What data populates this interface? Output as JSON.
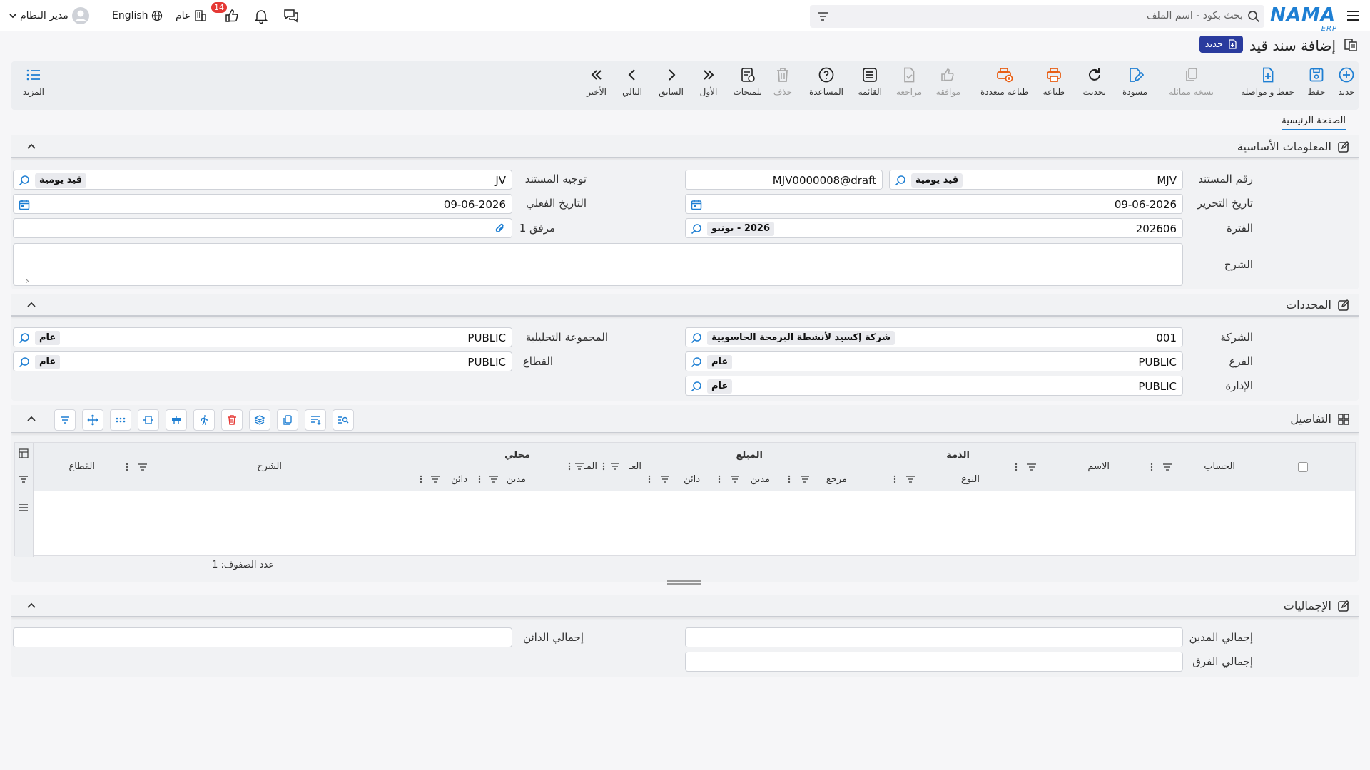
{
  "topbar": {
    "logo": "NAMA",
    "logo_sub": "ERP",
    "search_placeholder": "بحث بكود - اسم الملف",
    "user_name": "مدير النظام",
    "language": "English",
    "scope": "عام",
    "notification_count": "14"
  },
  "page": {
    "title": "إضافة سند قيد",
    "new_badge": "جديد"
  },
  "toolbar": {
    "new": "جديد",
    "save": "حفظ",
    "save_continue": "حفظ و مواصلة",
    "copy": "نسخة مماثلة",
    "draft": "مسودة",
    "refresh": "تحديث",
    "print": "طباعة",
    "multi_print": "طباعة متعددة",
    "approve": "موافقة",
    "review": "مراجعة",
    "list": "القائمة",
    "help": "المساعدة",
    "delete": "حذف",
    "hints": "تلميحات",
    "first": "الأول",
    "previous": "السابق",
    "next": "التالي",
    "last": "الأخير",
    "more": "المزيد"
  },
  "tabs": {
    "main": "الصفحة الرئيسية"
  },
  "basic": {
    "title": "المعلومات الأساسية",
    "doc_number_label": "رقم المستند",
    "doc_type_code": "MJV",
    "doc_type_name": "قيد يومية",
    "doc_code": "MJV0000008@draft",
    "doc_direction_label": "توجيه المستند",
    "doc_direction_code": "JV",
    "doc_direction_name": "قيد يومية",
    "edit_date_label": "تاريخ التحرير",
    "edit_date": "09-06-2026",
    "actual_date_label": "التاريخ الفعلي",
    "actual_date": "09-06-2026",
    "period_label": "الفترة",
    "period_code": "202606",
    "period_name": "2026 - يونيو",
    "attachment_label": "مرفق 1",
    "explanation_label": "الشرح"
  },
  "dimensions": {
    "title": "المحددات",
    "company_label": "الشركة",
    "company_code": "001",
    "company_name": "شركة إكسيد لأنشطة البرمجة الحاسوبية",
    "analytic_group_label": "المجموعة التحليلية",
    "analytic_group_code": "PUBLIC",
    "analytic_group_name": "عام",
    "branch_label": "الفرع",
    "branch_code": "PUBLIC",
    "branch_name": "عام",
    "sector_label": "القطاع",
    "sector_code": "PUBLIC",
    "sector_name": "عام",
    "department_label": "الإدارة",
    "department_code": "PUBLIC",
    "department_name": "عام"
  },
  "details": {
    "title": "التفاصيل",
    "columns": {
      "account": "الحساب",
      "name": "الاسم",
      "liability": "الذمة",
      "type": "النوع",
      "reference": "مرجع",
      "amount": "المبلغ",
      "debit": "مدين",
      "credit": "دائن",
      "currency": "العـ",
      "rate": "المـ",
      "local": "محلي",
      "local_debit": "مدين",
      "local_credit": "دائن",
      "explanation": "الشرح",
      "sector": "القطاع"
    },
    "row_count": "عدد الصفوف: 1"
  },
  "totals": {
    "title": "الإجماليات",
    "total_debit_label": "إجمالي المدين",
    "total_credit_label": "إجمالي الدائن",
    "total_diff_label": "إجمالي الفرق",
    "total_debit": "",
    "total_credit": "",
    "total_diff": ""
  }
}
